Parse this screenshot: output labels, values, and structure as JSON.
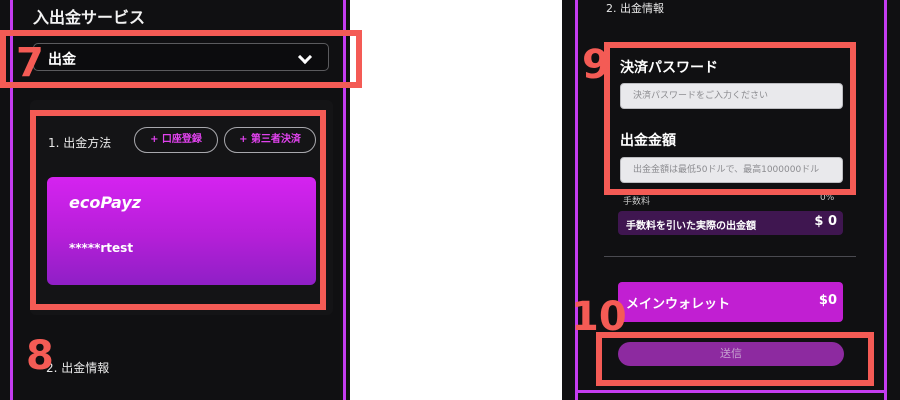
{
  "left": {
    "service_title": "入出金サービス",
    "mode_select": {
      "value": "出金"
    },
    "method_section": {
      "label": "1. 出金方法",
      "add_bank_label": "+ 口座登録",
      "add_third_party_label": "+ 第三者決済"
    },
    "card": {
      "brand": "ecoPayz",
      "account": "*****rtest"
    },
    "info_section_label": "2. 出金情報"
  },
  "right": {
    "info_section_label": "2. 出金情報",
    "password": {
      "label": "決済パスワード",
      "placeholder": "決済パスワードをご入力ください"
    },
    "amount": {
      "label": "出金金額",
      "placeholder": "出金金額は最低50ドルで、最高1000000ドル"
    },
    "fee": {
      "label": "手数料",
      "value": "0%"
    },
    "net_amount": {
      "label": "手数料を引いた実際の出金額",
      "value": "$ 0"
    },
    "wallet": {
      "label": "メインウォレット",
      "value": "$0"
    },
    "submit_label": "送信"
  },
  "annotations": [
    "7",
    "8",
    "9",
    "10"
  ],
  "colors": {
    "accent": "#c43cf0",
    "highlight": "#f45b55",
    "card_purple": "#d523f0",
    "wallet_purple": "#c11fd2",
    "background": "#101012"
  }
}
